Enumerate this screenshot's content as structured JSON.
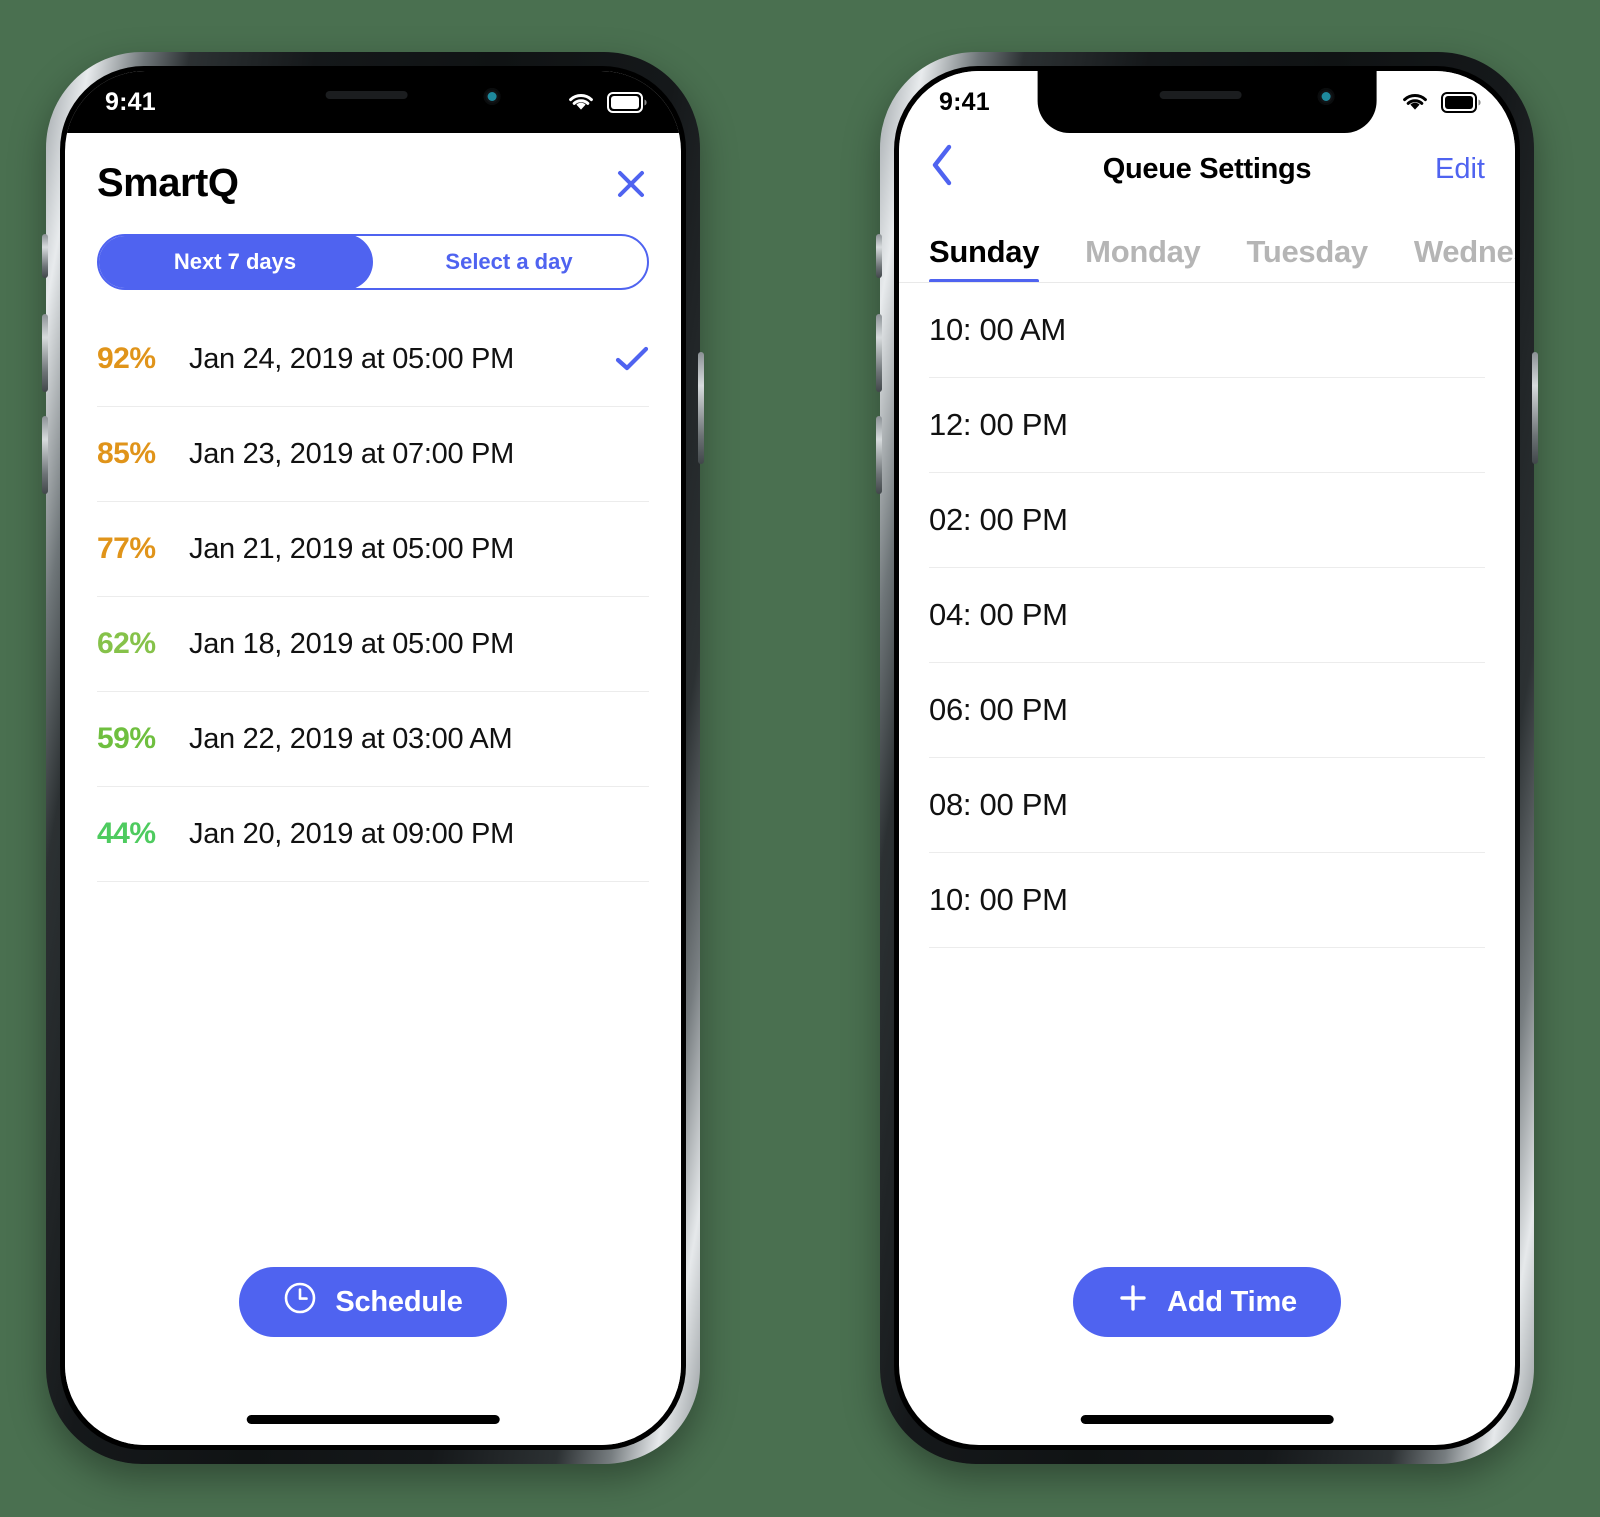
{
  "theme": {
    "page_background": "#4a7050",
    "accent_blue": "#4f63f0",
    "amber": "#e0941a",
    "olive_green": "#86c24a",
    "bright_green": "#4ecb5f"
  },
  "left_phone": {
    "status_bar": {
      "time": "9:41",
      "wifi_icon": "wifi-icon",
      "battery_icon": "battery-icon"
    },
    "header": {
      "title": "SmartQ",
      "close_icon": "close-icon"
    },
    "segmented_control": {
      "options": [
        {
          "label": "Next 7 days",
          "selected": true
        },
        {
          "label": "Select a day",
          "selected": false
        }
      ]
    },
    "slots": [
      {
        "percent": "92%",
        "color": "#e0941a",
        "datetime": "Jan 24, 2019 at 05:00 PM",
        "selected": true
      },
      {
        "percent": "85%",
        "color": "#e0941a",
        "datetime": "Jan 23, 2019 at 07:00 PM",
        "selected": false
      },
      {
        "percent": "77%",
        "color": "#e0941a",
        "datetime": "Jan 21, 2019 at 05:00 PM",
        "selected": false
      },
      {
        "percent": "62%",
        "color": "#86c24a",
        "datetime": "Jan 18, 2019 at 05:00 PM",
        "selected": false
      },
      {
        "percent": "59%",
        "color": "#6fbf3f",
        "datetime": "Jan 22, 2019 at 03:00 AM",
        "selected": false
      },
      {
        "percent": "44%",
        "color": "#4ecb5f",
        "datetime": "Jan 20, 2019 at 09:00 PM",
        "selected": false
      }
    ],
    "primary_button": {
      "label": "Schedule",
      "icon": "clock-icon"
    }
  },
  "right_phone": {
    "status_bar": {
      "time": "9:41",
      "wifi_icon": "wifi-icon",
      "battery_icon": "battery-icon"
    },
    "navbar": {
      "back_icon": "chevron-left-icon",
      "title": "Queue Settings",
      "edit_label": "Edit"
    },
    "day_tabs": [
      {
        "label": "Sunday",
        "active": true
      },
      {
        "label": "Monday",
        "active": false
      },
      {
        "label": "Tuesday",
        "active": false
      },
      {
        "label": "Wednesday",
        "active": false
      }
    ],
    "times": [
      "10: 00 AM",
      "12: 00 PM",
      "02: 00 PM",
      "04: 00 PM",
      "06: 00 PM",
      "08: 00 PM",
      "10: 00 PM"
    ],
    "primary_button": {
      "label": "Add Time",
      "icon": "plus-icon"
    }
  }
}
